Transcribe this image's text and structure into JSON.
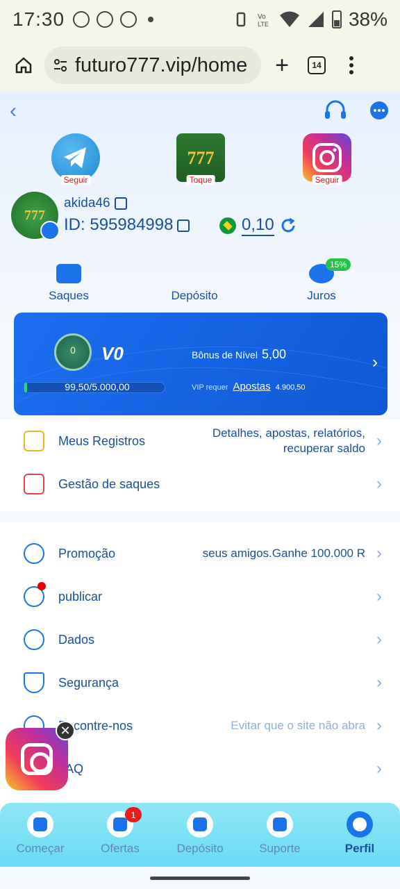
{
  "status": {
    "time": "17:30",
    "battery": "38%"
  },
  "browser": {
    "url": "futuro777.vip/home",
    "tabs": "14"
  },
  "social": {
    "telegram": "Seguir",
    "game": "Toque",
    "instagram": "Seguir"
  },
  "user": {
    "name": "akida46",
    "id_label": "ID:",
    "id": "595984998",
    "balance": "0,10"
  },
  "quick": {
    "saques": "Saques",
    "deposito": "Depósito",
    "juros": "Juros",
    "juros_badge": "15%"
  },
  "vip": {
    "level": "V0",
    "badge_number": "0",
    "progress_text": "99,50/5.000,00",
    "progress_fraction": 0.0199,
    "bonus_label": "Bônus de Nível",
    "bonus_value": "5,00",
    "req_label": "VIP requer",
    "req_link": "Apostas",
    "req_value": "4.900,50"
  },
  "menu_top": [
    {
      "label": "Meus Registros",
      "desc": "Detalhes, apostas, relatórios, recuperar saldo"
    },
    {
      "label": "Gestão de saques",
      "desc": ""
    }
  ],
  "menu_main": [
    {
      "label": "Promoção",
      "desc": "seus amigos.Ganhe 100.000 R"
    },
    {
      "label": "publicar",
      "desc": ""
    },
    {
      "label": "Dados",
      "desc": ""
    },
    {
      "label": "Segurança",
      "desc": ""
    },
    {
      "label": "Encontre-nos",
      "desc": "Evitar que o site não abra"
    },
    {
      "label": "FAQ",
      "desc": ""
    }
  ],
  "tabbar": {
    "tabs": [
      "Começar",
      "Ofertas",
      "Depósito",
      "Suporte",
      "Perfil"
    ],
    "active": "Perfil",
    "ofertas_badge": "1"
  },
  "colors": {
    "brand": "#1a73e8",
    "card": "#1c6ef0",
    "tabbar": "#7de2f6"
  }
}
